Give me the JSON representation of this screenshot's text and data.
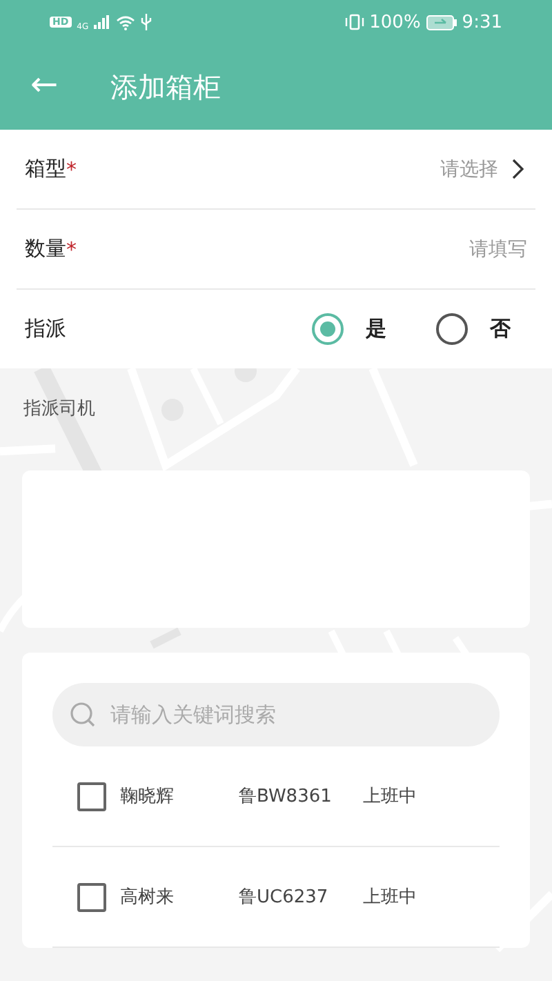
{
  "status_bar": {
    "hd": "HD",
    "network": "4G",
    "battery": "100%",
    "time": "9:31"
  },
  "header": {
    "back": "←",
    "title": "添加箱柜"
  },
  "form": [
    {
      "kind": "select",
      "label": "箱型",
      "required_mark": "*",
      "placeholder": "请选择"
    },
    {
      "kind": "input",
      "label": "数量",
      "required_mark": "*",
      "placeholder": "请填写"
    },
    {
      "kind": "radio",
      "label": "指派",
      "options": [
        {
          "label": "是",
          "selected": true
        },
        {
          "label": "否",
          "selected": false
        }
      ]
    }
  ],
  "assign_section": {
    "label": "指派司机"
  },
  "driver_list": {
    "search": {
      "placeholder": "请输入关键词搜索"
    },
    "drivers": [
      {
        "name": "鞠晓辉",
        "plate": "鲁BW8361",
        "status": "上班中",
        "checked": false
      },
      {
        "name": "高树来",
        "plate": "鲁UC6237",
        "status": "上班中",
        "checked": false
      }
    ]
  }
}
